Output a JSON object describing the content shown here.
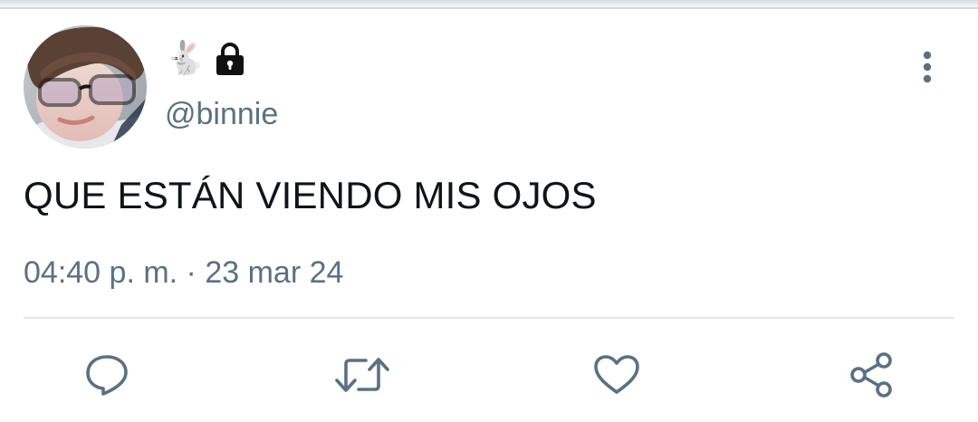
{
  "user": {
    "display_emoji": "🐇",
    "lock_icon": "lock-icon",
    "handle": "@binnie"
  },
  "tweet": {
    "text": "QUE ESTÁN VIENDO MIS OJOS",
    "time": "04:40 p. m.",
    "separator": " · ",
    "date": "23 mar 24"
  },
  "actions": {
    "reply_icon": "reply-icon",
    "retweet_icon": "retweet-icon",
    "like_icon": "heart-icon",
    "share_icon": "share-icon",
    "more_icon": "more-vertical-icon"
  },
  "colors": {
    "text": "#0f1419",
    "secondary": "#5b7083",
    "divider": "#e1e6ea"
  }
}
